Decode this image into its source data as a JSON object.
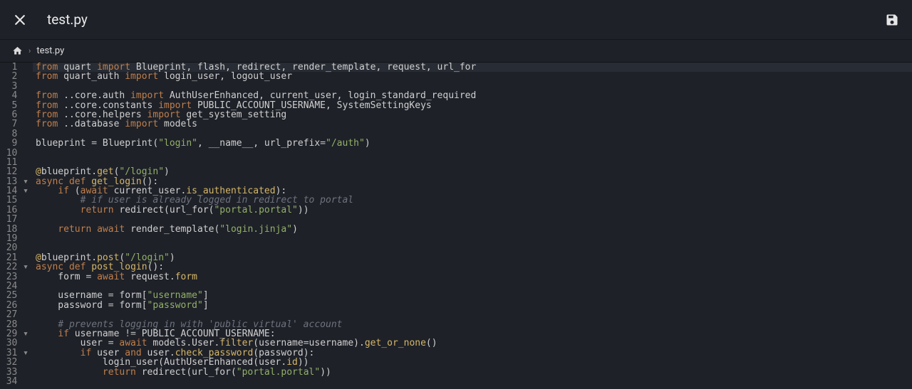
{
  "titlebar": {
    "filename": "test.py"
  },
  "breadcrumb": {
    "filename": "test.py"
  },
  "editor": {
    "current_line": 1,
    "lines": [
      {
        "n": 1,
        "fold": "",
        "tokens": [
          [
            "kw",
            "from"
          ],
          [
            "name",
            " quart "
          ],
          [
            "kw",
            "import"
          ],
          [
            "name",
            " Blueprint, flash, redirect, render_template, request, url_for"
          ]
        ]
      },
      {
        "n": 2,
        "fold": "",
        "tokens": [
          [
            "kw",
            "from"
          ],
          [
            "name",
            " quart_auth "
          ],
          [
            "kw",
            "import"
          ],
          [
            "name",
            " login_user, logout_user"
          ]
        ]
      },
      {
        "n": 3,
        "fold": "",
        "tokens": []
      },
      {
        "n": 4,
        "fold": "",
        "tokens": [
          [
            "kw",
            "from"
          ],
          [
            "name",
            " ..core.auth "
          ],
          [
            "kw",
            "import"
          ],
          [
            "name",
            " AuthUserEnhanced, current_user, login_standard_required"
          ]
        ]
      },
      {
        "n": 5,
        "fold": "",
        "tokens": [
          [
            "kw",
            "from"
          ],
          [
            "name",
            " ..core.constants "
          ],
          [
            "kw",
            "import"
          ],
          [
            "name",
            " PUBLIC_ACCOUNT_USERNAME, SystemSettingKeys"
          ]
        ]
      },
      {
        "n": 6,
        "fold": "",
        "tokens": [
          [
            "kw",
            "from"
          ],
          [
            "name",
            " ..core.helpers "
          ],
          [
            "kw",
            "import"
          ],
          [
            "name",
            " get_system_setting"
          ]
        ]
      },
      {
        "n": 7,
        "fold": "",
        "tokens": [
          [
            "kw",
            "from"
          ],
          [
            "name",
            " ..database "
          ],
          [
            "kw",
            "import"
          ],
          [
            "name",
            " models"
          ]
        ]
      },
      {
        "n": 8,
        "fold": "",
        "tokens": []
      },
      {
        "n": 9,
        "fold": "",
        "tokens": [
          [
            "name",
            "blueprint "
          ],
          [
            "op",
            "="
          ],
          [
            "name",
            " Blueprint("
          ],
          [
            "str",
            "\"login\""
          ],
          [
            "name",
            ", __name__, url_prefix"
          ],
          [
            "op",
            "="
          ],
          [
            "str",
            "\"/auth\""
          ],
          [
            "name",
            ")"
          ]
        ]
      },
      {
        "n": 10,
        "fold": "",
        "tokens": []
      },
      {
        "n": 11,
        "fold": "",
        "tokens": []
      },
      {
        "n": 12,
        "fold": "",
        "tokens": [
          [
            "dec",
            "@"
          ],
          [
            "name",
            "blueprint."
          ],
          [
            "fn",
            "get"
          ],
          [
            "name",
            "("
          ],
          [
            "str",
            "\"/login\""
          ],
          [
            "name",
            ")"
          ]
        ]
      },
      {
        "n": 13,
        "fold": "▾",
        "tokens": [
          [
            "kw",
            "async"
          ],
          [
            "name",
            " "
          ],
          [
            "kw",
            "def"
          ],
          [
            "name",
            " "
          ],
          [
            "fn",
            "get_login"
          ],
          [
            "name",
            "():"
          ]
        ]
      },
      {
        "n": 14,
        "fold": "▾",
        "tokens": [
          [
            "name",
            "    "
          ],
          [
            "kw",
            "if"
          ],
          [
            "name",
            " ("
          ],
          [
            "kw",
            "await"
          ],
          [
            "name",
            " current_user."
          ],
          [
            "fn",
            "is_authenticated"
          ],
          [
            "name",
            "):"
          ]
        ]
      },
      {
        "n": 15,
        "fold": "",
        "tokens": [
          [
            "name",
            "        "
          ],
          [
            "cmt",
            "# if user is already logged in redirect to portal"
          ]
        ]
      },
      {
        "n": 16,
        "fold": "",
        "tokens": [
          [
            "name",
            "        "
          ],
          [
            "kw",
            "return"
          ],
          [
            "name",
            " redirect(url_for("
          ],
          [
            "str",
            "\"portal.portal\""
          ],
          [
            "name",
            "))"
          ]
        ]
      },
      {
        "n": 17,
        "fold": "",
        "tokens": []
      },
      {
        "n": 18,
        "fold": "",
        "tokens": [
          [
            "name",
            "    "
          ],
          [
            "kw",
            "return"
          ],
          [
            "name",
            " "
          ],
          [
            "kw",
            "await"
          ],
          [
            "name",
            " render_template("
          ],
          [
            "str",
            "\"login.jinja\""
          ],
          [
            "name",
            ")"
          ]
        ]
      },
      {
        "n": 19,
        "fold": "",
        "tokens": []
      },
      {
        "n": 20,
        "fold": "",
        "tokens": []
      },
      {
        "n": 21,
        "fold": "",
        "tokens": [
          [
            "dec",
            "@"
          ],
          [
            "name",
            "blueprint."
          ],
          [
            "fn",
            "post"
          ],
          [
            "name",
            "("
          ],
          [
            "str",
            "\"/login\""
          ],
          [
            "name",
            ")"
          ]
        ]
      },
      {
        "n": 22,
        "fold": "▾",
        "tokens": [
          [
            "kw",
            "async"
          ],
          [
            "name",
            " "
          ],
          [
            "kw",
            "def"
          ],
          [
            "name",
            " "
          ],
          [
            "fn",
            "post_login"
          ],
          [
            "name",
            "():"
          ]
        ]
      },
      {
        "n": 23,
        "fold": "",
        "tokens": [
          [
            "name",
            "    form "
          ],
          [
            "op",
            "="
          ],
          [
            "name",
            " "
          ],
          [
            "kw",
            "await"
          ],
          [
            "name",
            " request."
          ],
          [
            "fn",
            "form"
          ]
        ]
      },
      {
        "n": 24,
        "fold": "",
        "tokens": []
      },
      {
        "n": 25,
        "fold": "",
        "tokens": [
          [
            "name",
            "    username "
          ],
          [
            "op",
            "="
          ],
          [
            "name",
            " form["
          ],
          [
            "str",
            "\"username\""
          ],
          [
            "name",
            "]"
          ]
        ]
      },
      {
        "n": 26,
        "fold": "",
        "tokens": [
          [
            "name",
            "    password "
          ],
          [
            "op",
            "="
          ],
          [
            "name",
            " form["
          ],
          [
            "str",
            "\"password\""
          ],
          [
            "name",
            "]"
          ]
        ]
      },
      {
        "n": 27,
        "fold": "",
        "tokens": []
      },
      {
        "n": 28,
        "fold": "",
        "tokens": [
          [
            "name",
            "    "
          ],
          [
            "cmt",
            "# prevents logging in with 'public virtual' account"
          ]
        ]
      },
      {
        "n": 29,
        "fold": "▾",
        "tokens": [
          [
            "name",
            "    "
          ],
          [
            "kw",
            "if"
          ],
          [
            "name",
            " username "
          ],
          [
            "op",
            "!="
          ],
          [
            "name",
            " PUBLIC_ACCOUNT_USERNAME:"
          ]
        ]
      },
      {
        "n": 30,
        "fold": "",
        "tokens": [
          [
            "name",
            "        user "
          ],
          [
            "op",
            "="
          ],
          [
            "name",
            " "
          ],
          [
            "kw",
            "await"
          ],
          [
            "name",
            " models.User."
          ],
          [
            "fn",
            "filter"
          ],
          [
            "name",
            "(username"
          ],
          [
            "op",
            "="
          ],
          [
            "name",
            "username)."
          ],
          [
            "fn",
            "get_or_none"
          ],
          [
            "name",
            "()"
          ]
        ]
      },
      {
        "n": 31,
        "fold": "▾",
        "tokens": [
          [
            "name",
            "        "
          ],
          [
            "kw",
            "if"
          ],
          [
            "name",
            " user "
          ],
          [
            "kw",
            "and"
          ],
          [
            "name",
            " user."
          ],
          [
            "fn",
            "check_password"
          ],
          [
            "name",
            "(password):"
          ]
        ]
      },
      {
        "n": 32,
        "fold": "",
        "tokens": [
          [
            "name",
            "            login_user(AuthUserEnhanced(user."
          ],
          [
            "fn",
            "id"
          ],
          [
            "name",
            "))"
          ]
        ]
      },
      {
        "n": 33,
        "fold": "",
        "tokens": [
          [
            "name",
            "            "
          ],
          [
            "kw",
            "return"
          ],
          [
            "name",
            " redirect(url_for("
          ],
          [
            "str",
            "\"portal.portal\""
          ],
          [
            "name",
            "))"
          ]
        ]
      },
      {
        "n": 34,
        "fold": "",
        "tokens": []
      }
    ]
  }
}
